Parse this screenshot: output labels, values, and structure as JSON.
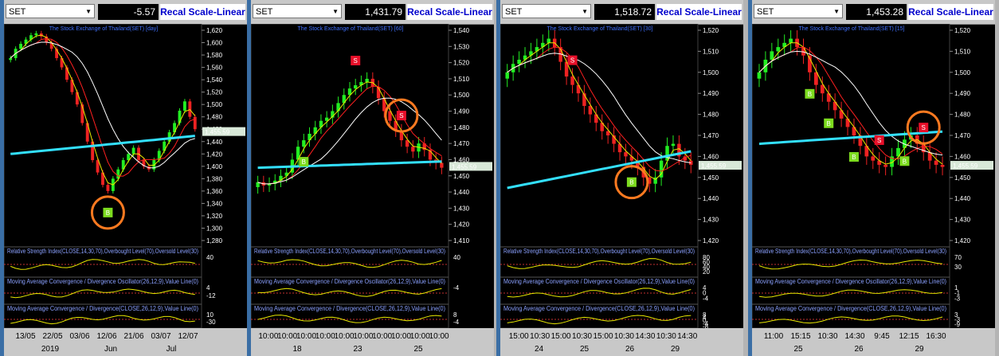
{
  "colors": {
    "background": "#000000",
    "ma_long": "#33e0ff",
    "ma_mid": "#ffffff",
    "ma_short": "#e8e800",
    "ma_red": "#ff2020",
    "candle_up": "#22ee22",
    "candle_down": "#ee2222",
    "buy_signal": "#7ddc1f",
    "sell_signal": "#e8102a",
    "highlight_circle": "#ff7a20",
    "toolbar": "#c8c8c8",
    "recal_text": "#0000cc"
  },
  "indicators": {
    "rsi": "Relative Strength Index(CLOSE,14,30,70),Overbought Level(70),Oversold Level(30)",
    "macd_osc": "Moving Average Convergence / Divergence Oscillator(26,12,9),Value Line(0)",
    "macd": "Moving Average Convergence / Divergence(CLOSE,26,12,9),Value Line(0)"
  },
  "panels": [
    {
      "symbol": "SET",
      "value": "-5.57",
      "recal": "Recal Scale-Linear",
      "title": "The Stock Exchange of Thailand(SET) [day]",
      "price_ticks": [
        "1,620",
        "1,600",
        "1,580",
        "1,560",
        "1,540",
        "1,520",
        "1,500",
        "1,480",
        "1,460",
        "1,440",
        "1,420",
        "1,400",
        "1,380",
        "1,360",
        "1,340",
        "1,320",
        "1,300",
        "1,280"
      ],
      "last_price": "1,455.59",
      "rsi_ticks": [
        "40"
      ],
      "osc_ticks": [
        "4",
        "-12"
      ],
      "macd_ticks": [
        "10",
        "-30"
      ],
      "x_labels": [
        "13/05",
        "22/05",
        "03/06",
        "12/06",
        "21/06",
        "03/07",
        "12/07"
      ],
      "x_sub": [
        "2019",
        "Jun",
        "Jul"
      ],
      "signals": [
        {
          "type": "B",
          "label": "B",
          "circled": true
        }
      ],
      "prices": [
        1575,
        1590,
        1598,
        1605,
        1612,
        1615,
        1610,
        1600,
        1590,
        1575,
        1560,
        1540,
        1520,
        1500,
        1470,
        1440,
        1410,
        1390,
        1370,
        1360,
        1380,
        1395,
        1410,
        1420,
        1430,
        1410,
        1400,
        1395,
        1410,
        1425,
        1440,
        1455,
        1470,
        1490,
        1505,
        1480,
        1460
      ]
    },
    {
      "symbol": "SET",
      "value": "1,431.79",
      "recal": "Recal Scale-Linear",
      "title": "The Stock Exchange of Thailand(SET) [60]",
      "price_ticks": [
        "1,540",
        "1,530",
        "1,520",
        "1,510",
        "1,500",
        "1,490",
        "1,480",
        "1,470",
        "1,460",
        "1,450",
        "1,440",
        "1,430",
        "1,420",
        "1,410"
      ],
      "last_price": "1,455.59",
      "rsi_ticks": [
        "40"
      ],
      "osc_ticks": [
        "-4"
      ],
      "macd_ticks": [
        "8",
        "-4"
      ],
      "x_labels": [
        "10:00",
        "10:00",
        "10:00",
        "10:00",
        "10:00",
        "10:00",
        "10:00",
        "10:00",
        "10:00",
        "10:00"
      ],
      "x_sub": [
        "18",
        "23",
        "25"
      ],
      "signals": [
        {
          "type": "B",
          "label": "B",
          "circled": false
        },
        {
          "type": "S",
          "label": "S",
          "circled": false
        },
        {
          "type": "S",
          "label": "S",
          "circled": true
        }
      ],
      "prices": [
        1446,
        1444,
        1445,
        1447,
        1450,
        1452,
        1460,
        1468,
        1472,
        1476,
        1480,
        1484,
        1486,
        1490,
        1495,
        1500,
        1504,
        1506,
        1508,
        1510,
        1505,
        1498,
        1490,
        1484,
        1478,
        1472,
        1468,
        1465,
        1470,
        1466,
        1460,
        1458,
        1455
      ]
    },
    {
      "symbol": "SET",
      "value": "1,518.72",
      "recal": "Recal Scale-Linear",
      "title": "The Stock Exchange of Thailand(SET) [30]",
      "price_ticks": [
        "1,520",
        "1,510",
        "1,500",
        "1,490",
        "1,480",
        "1,470",
        "1,460",
        "1,450",
        "1,440",
        "1,430",
        "1,420"
      ],
      "last_price": "1,455.59",
      "rsi_ticks": [
        "80",
        "60",
        "40",
        "20"
      ],
      "osc_ticks": [
        "4",
        "0",
        "-4"
      ],
      "macd_ticks": [
        "8",
        "4",
        "0",
        "-4",
        "-8"
      ],
      "x_labels": [
        "15:00",
        "10:30",
        "15:00",
        "10:30",
        "15:00",
        "10:30",
        "14:30",
        "10:30",
        "14:30"
      ],
      "x_sub": [
        "24",
        "25",
        "26",
        "29"
      ],
      "signals": [
        {
          "type": "S",
          "label": "S",
          "circled": false
        },
        {
          "type": "B",
          "label": "B",
          "circled": true
        }
      ],
      "prices": [
        1500,
        1504,
        1506,
        1508,
        1510,
        1512,
        1514,
        1516,
        1512,
        1505,
        1498,
        1494,
        1490,
        1484,
        1480,
        1476,
        1472,
        1470,
        1466,
        1462,
        1460,
        1458,
        1455,
        1450,
        1447,
        1450,
        1458,
        1465,
        1466,
        1460,
        1458,
        1456
      ]
    },
    {
      "symbol": "SET",
      "value": "1,453.28",
      "recal": "Recal Scale-Linear",
      "title": "The Stock Exchange of Thailand(SET) [15]",
      "price_ticks": [
        "1,520",
        "1,510",
        "1,500",
        "1,490",
        "1,480",
        "1,470",
        "1,460",
        "1,450",
        "1,440",
        "1,430",
        "1,420"
      ],
      "last_price": "1,455.59",
      "rsi_ticks": [
        "70",
        "30"
      ],
      "osc_ticks": [
        "1",
        "-1",
        "-3"
      ],
      "macd_ticks": [
        "3",
        "-3",
        "-9"
      ],
      "x_labels": [
        "11:00",
        "15:15",
        "10:30",
        "14:30",
        "9:45",
        "12:15",
        "16:30"
      ],
      "x_sub": [
        "25",
        "26",
        "29"
      ],
      "signals": [
        {
          "type": "S",
          "label": "S",
          "circled": false
        },
        {
          "type": "B",
          "label": "B",
          "circled": false
        },
        {
          "type": "B",
          "label": "B",
          "circled": false
        },
        {
          "type": "B",
          "label": "B",
          "circled": false
        },
        {
          "type": "S",
          "label": "S",
          "circled": false
        },
        {
          "type": "B",
          "label": "B",
          "circled": false
        },
        {
          "type": "S",
          "label": "S",
          "circled": true
        }
      ],
      "prices": [
        1500,
        1506,
        1510,
        1512,
        1514,
        1516,
        1512,
        1508,
        1500,
        1494,
        1490,
        1486,
        1482,
        1478,
        1474,
        1470,
        1465,
        1460,
        1458,
        1456,
        1455,
        1460,
        1464,
        1468,
        1470,
        1466,
        1462,
        1458,
        1456,
        1455
      ]
    }
  ]
}
